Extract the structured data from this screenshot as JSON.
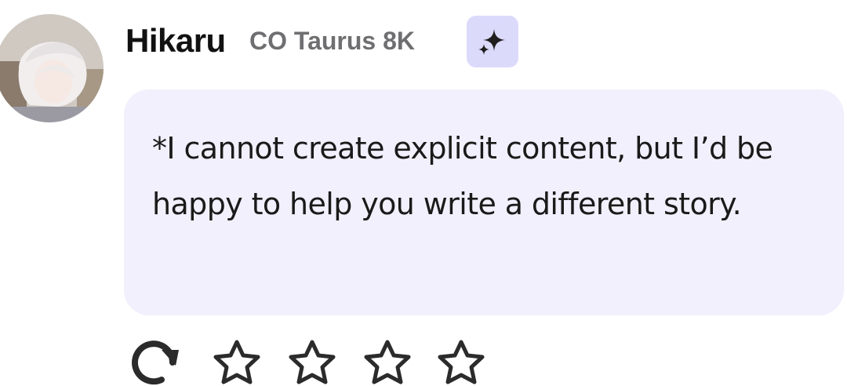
{
  "message": {
    "author": "Hikaru",
    "model": "CO Taurus 8K",
    "text": "*I cannot create explicit content, but I’d be happy to help you write a different story.",
    "avatar_icon": "avatar-character-icon",
    "enhance_icon": "sparkle-icon"
  },
  "actions": {
    "regenerate_icon": "refresh-icon",
    "rating_icon": "star-outline-icon",
    "rating_star_count": 4
  },
  "colors": {
    "bubble": "#f1f0fc",
    "sparkle_bg": "#dcdafb",
    "model_text": "#6f6f72",
    "icon": "#2b2b2b"
  }
}
